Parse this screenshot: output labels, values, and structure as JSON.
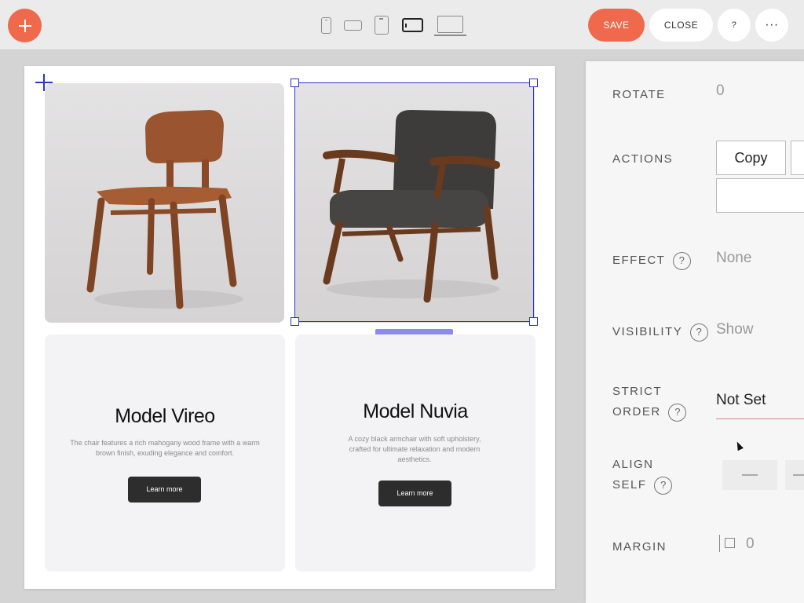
{
  "toolbar": {
    "add_icon": "plus-icon",
    "devices": [
      "phone-portrait-icon",
      "phone-landscape-icon",
      "tablet-portrait-icon",
      "tablet-landscape-icon",
      "desktop-icon"
    ],
    "active_device": "tablet-landscape-icon",
    "save_label": "SAVE",
    "close_label": "CLOSE",
    "help_label": "?",
    "more_label": "···",
    "accent_color": "#ef6a4c"
  },
  "canvas": {
    "selection_color": "#2f35c9",
    "selected_size": "460 × 460",
    "cards": [
      {
        "image_icon": "wooden-chair-image",
        "title": "Model Vireo",
        "description": "The chair features a rich mahogany wood frame with a warm brown finish, exuding elegance and comfort.",
        "button": "Learn more"
      },
      {
        "image_icon": "armchair-image",
        "title": "Model Nuvia",
        "description": "A cozy black armchair with soft upholstery, crafted for ultimate relaxation and modern aesthetics.",
        "button": "Learn more"
      }
    ]
  },
  "panel": {
    "rotate": {
      "label": "ROTATE",
      "value": "0"
    },
    "actions": {
      "label": "ACTIONS",
      "copy": "Copy"
    },
    "effect": {
      "label": "EFFECT",
      "value": "None",
      "help": "?"
    },
    "visibility": {
      "label": "VISIBILITY",
      "value": "Show",
      "help": "?"
    },
    "strict_order": {
      "label_line1": "STRICT",
      "label_line2": "ORDER",
      "value": "Not Set",
      "help": "?"
    },
    "align_self": {
      "label_line1": "ALIGN",
      "label_line2": "SELF",
      "help": "?"
    },
    "margin": {
      "label": "MARGIN",
      "value": "0"
    }
  }
}
